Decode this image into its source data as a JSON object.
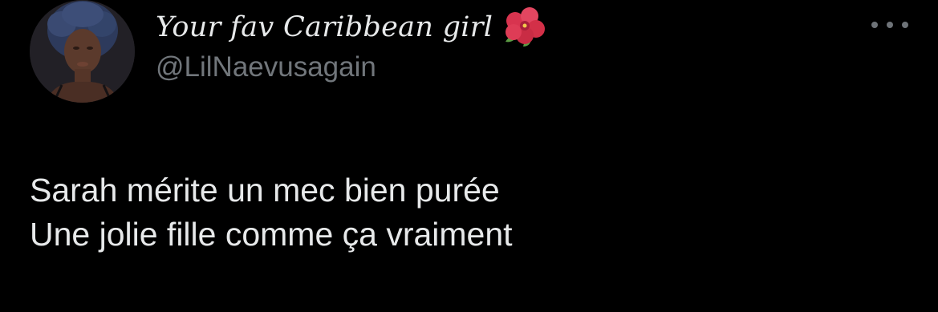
{
  "author": {
    "display_name": "Your fav Caribbean girl",
    "name_emoji": "hibiscus-icon",
    "handle": "@LilNaevusagain",
    "avatar": "profile-photo"
  },
  "menu": {
    "icon": "more-options-icon"
  },
  "tweet": {
    "lines": [
      "Sarah mérite un mec bien purée",
      "Une jolie fille comme ça vraiment"
    ]
  },
  "colors": {
    "background": "#000000",
    "primary_text": "#e7e9ea",
    "secondary_text": "#71767b",
    "hibiscus": "#d8344f"
  }
}
